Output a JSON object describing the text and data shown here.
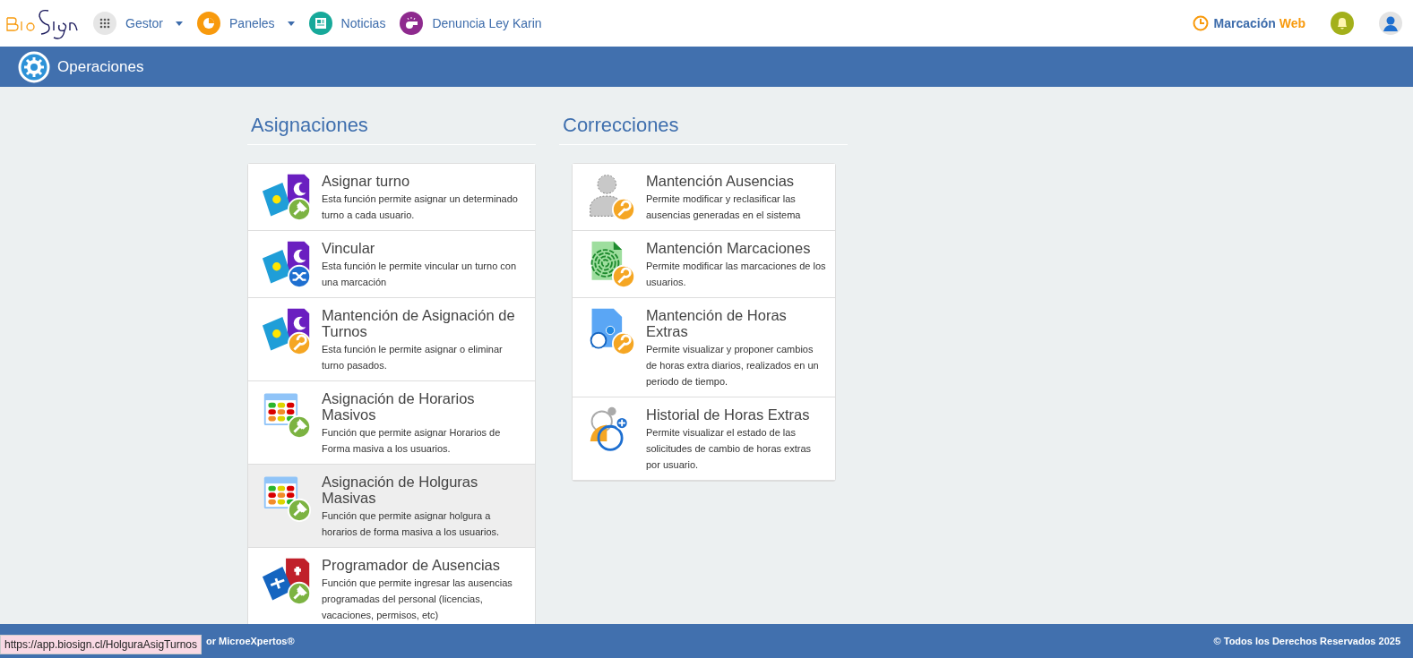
{
  "nav": {
    "items": [
      {
        "label": "Gestor",
        "kind": "grid",
        "dropdown": true
      },
      {
        "label": "Paneles",
        "kind": "chart",
        "dropdown": true
      },
      {
        "label": "Noticias",
        "kind": "news",
        "dropdown": false
      },
      {
        "label": "Denuncia Ley Karin",
        "kind": "whistle",
        "dropdown": false
      }
    ],
    "clock_label": "Marcación",
    "clock_label_accent": "Web"
  },
  "page_title": "Operaciones",
  "sections": [
    {
      "title": "Asignaciones",
      "items": [
        {
          "title": "Asignar turno",
          "description": "Esta función permite asignar un determinado turno a cada usuario.",
          "kind": "shift-pin",
          "hovered": false
        },
        {
          "title": "Vincular",
          "description": "Esta función le permite vincular un turno con una marcación",
          "kind": "shift-shuffle",
          "hovered": false
        },
        {
          "title": "Mantención de Asignación de Turnos",
          "description": "Esta función le permite asignar o eliminar turno pasados.",
          "kind": "shift-wrench",
          "hovered": false
        },
        {
          "title": "Asignación de Horarios Masivos",
          "description": "Función que permite asignar Horarios de Forma masiva a los usuarios.",
          "kind": "calendar-pin",
          "hovered": false
        },
        {
          "title": "Asignación de Holguras Masivas",
          "description": "Función que permite asignar holgura a horarios de forma masiva a los usuarios.",
          "kind": "calendar-pin",
          "hovered": true
        },
        {
          "title": "Programador de Ausencias",
          "description": "Función que permite ingresar las ausencias programadas del personal (licencias, vacaciones, permisos, etc)",
          "kind": "absence-pin",
          "hovered": false
        }
      ]
    },
    {
      "title": "Correcciones",
      "items": [
        {
          "title": "Mantención Ausencias",
          "description": "Permite modificar y reclasificar las ausencias generadas en el sistema",
          "kind": "person-wrench",
          "hovered": false
        },
        {
          "title": "Mantención Marcaciones",
          "description": "Permite modificar las marcaciones de los usuarios.",
          "kind": "fingerprint-wrench",
          "hovered": false
        },
        {
          "title": "Mantención de Horas Extras",
          "description": "Permite visualizar y proponer cambios de horas extra diarios, realizados en un periodo de tiempo.",
          "kind": "clockdoc-wrench",
          "hovered": false
        },
        {
          "title": "Historial de Horas Extras",
          "description": "Permite visualizar el estado de las solicitudes de cambio de horas extras por usuario.",
          "kind": "clocks-history",
          "hovered": false
        }
      ]
    }
  ],
  "footer": {
    "left": "or MicroeXpertos®",
    "right": "© Todos los Derechos Reservados 2025"
  },
  "status_url": "https://app.biosign.cl/HolguraAsigTurnos"
}
